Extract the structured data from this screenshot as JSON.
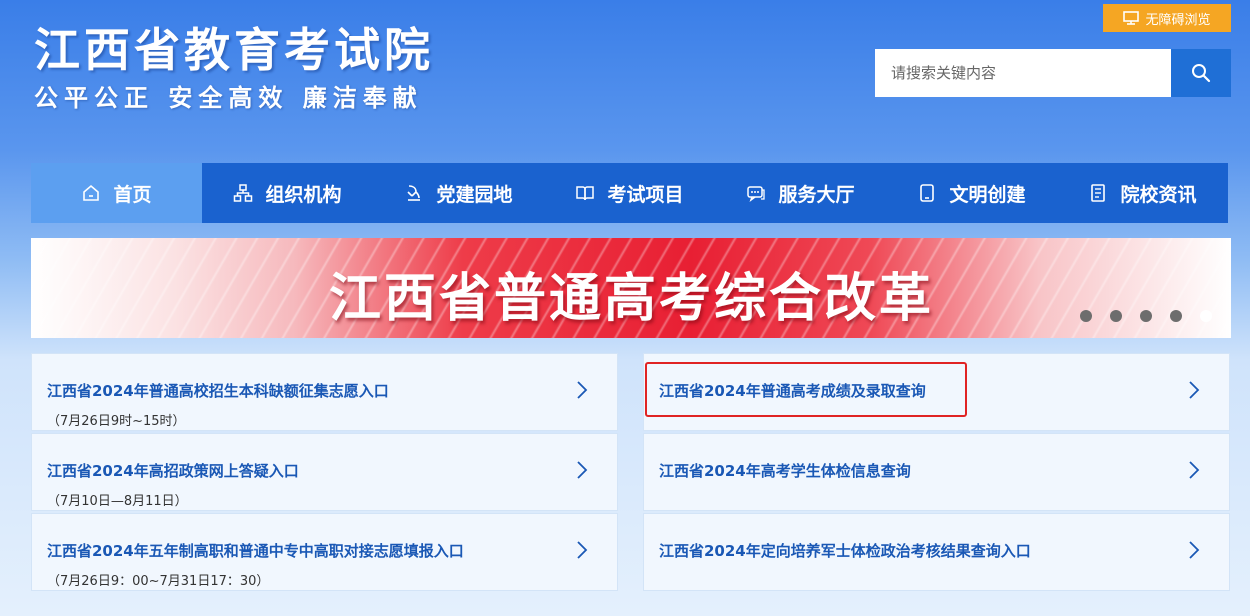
{
  "header": {
    "site_title": "江西省教育考试院",
    "slogan": "公平公正  安全高效  廉洁奉献",
    "accessibility_label": "无障碍浏览",
    "search_placeholder": "请搜索关键内容"
  },
  "nav": {
    "items": [
      {
        "label": "首页",
        "icon": "home-icon",
        "active": true
      },
      {
        "label": "组织机构",
        "icon": "org-chart-icon"
      },
      {
        "label": "党建园地",
        "icon": "party-building-icon"
      },
      {
        "label": "考试项目",
        "icon": "book-icon"
      },
      {
        "label": "服务大厅",
        "icon": "chat-service-icon"
      },
      {
        "label": "文明创建",
        "icon": "tablet-icon"
      },
      {
        "label": "院校资讯",
        "icon": "document-icon"
      }
    ]
  },
  "banner": {
    "title": "江西省普通高考综合改革",
    "slide_count": 5,
    "active_slide": 5
  },
  "cards": [
    {
      "title": "江西省2024年普通高校招生本科缺额征集志愿入口",
      "subtitle": "（7月26日9时~15时）"
    },
    {
      "title": "江西省2024年普通高考成绩及录取查询",
      "subtitle": ""
    },
    {
      "title": "江西省2024年高招政策网上答疑入口",
      "subtitle": "（7月10日—8月11日）"
    },
    {
      "title": "江西省2024年高考学生体检信息查询",
      "subtitle": ""
    },
    {
      "title": "江西省2024年五年制高职和普通中专中高职对接志愿填报入口",
      "subtitle": "（7月26日9：00~7月31日17：30）"
    },
    {
      "title": "江西省2024年定向培养军士体检政治考核结果查询入口",
      "subtitle": ""
    }
  ],
  "colors": {
    "nav_bg": "#1a62cf",
    "nav_active": "#5c9ff0",
    "accent_orange": "#f5a623",
    "card_title": "#1a58b5",
    "highlight": "#e02424"
  }
}
